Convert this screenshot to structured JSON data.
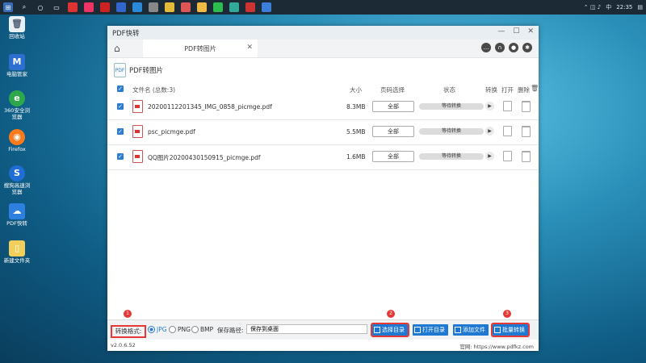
{
  "taskbar": {
    "time": "22:35",
    "lang": "中"
  },
  "desktop": {
    "icons": [
      {
        "label": "回收站"
      },
      {
        "label": "电脑管家"
      },
      {
        "label": "360安全浏览器"
      },
      {
        "label": "Firefox"
      },
      {
        "label": "搜狗高速浏览器"
      },
      {
        "label": "PDF快转"
      },
      {
        "label": "新建文件夹"
      }
    ]
  },
  "window": {
    "title": "PDF快转",
    "tab_label": "PDF转图片",
    "section_title": "PDF转图片",
    "columns": {
      "filename": "文件名 (总数:3)",
      "size": "大小",
      "page_select": "页码选择",
      "status": "状态",
      "convert": "转换",
      "open": "打开",
      "delete": "删除"
    },
    "files": [
      {
        "name": "20200112201345_IMG_0858_picmge.pdf",
        "size": "8.3MB",
        "pages": "全部",
        "status": "等待转换"
      },
      {
        "name": "psc_picmge.pdf",
        "size": "5.5MB",
        "pages": "全部",
        "status": "等待转换"
      },
      {
        "name": "QQ图片20200430150915_picmge.pdf",
        "size": "1.6MB",
        "pages": "全部",
        "status": "等待转换"
      }
    ],
    "bottom": {
      "format_label": "转换格式:",
      "formats": [
        "JPG",
        "PNG",
        "BMP"
      ],
      "selected_format": "JPG",
      "save_path_label": "保存路径:",
      "save_path_value": "保存到桌面",
      "btn_choose_dir": "选择目录",
      "btn_open_dir": "打开目录",
      "btn_add_file": "添加文件",
      "btn_batch": "批量转换",
      "badges": [
        "1",
        "2",
        "3"
      ]
    },
    "footer": {
      "version": "v2.0.6.52",
      "website": "官网: https://www.pdfkz.com"
    }
  }
}
